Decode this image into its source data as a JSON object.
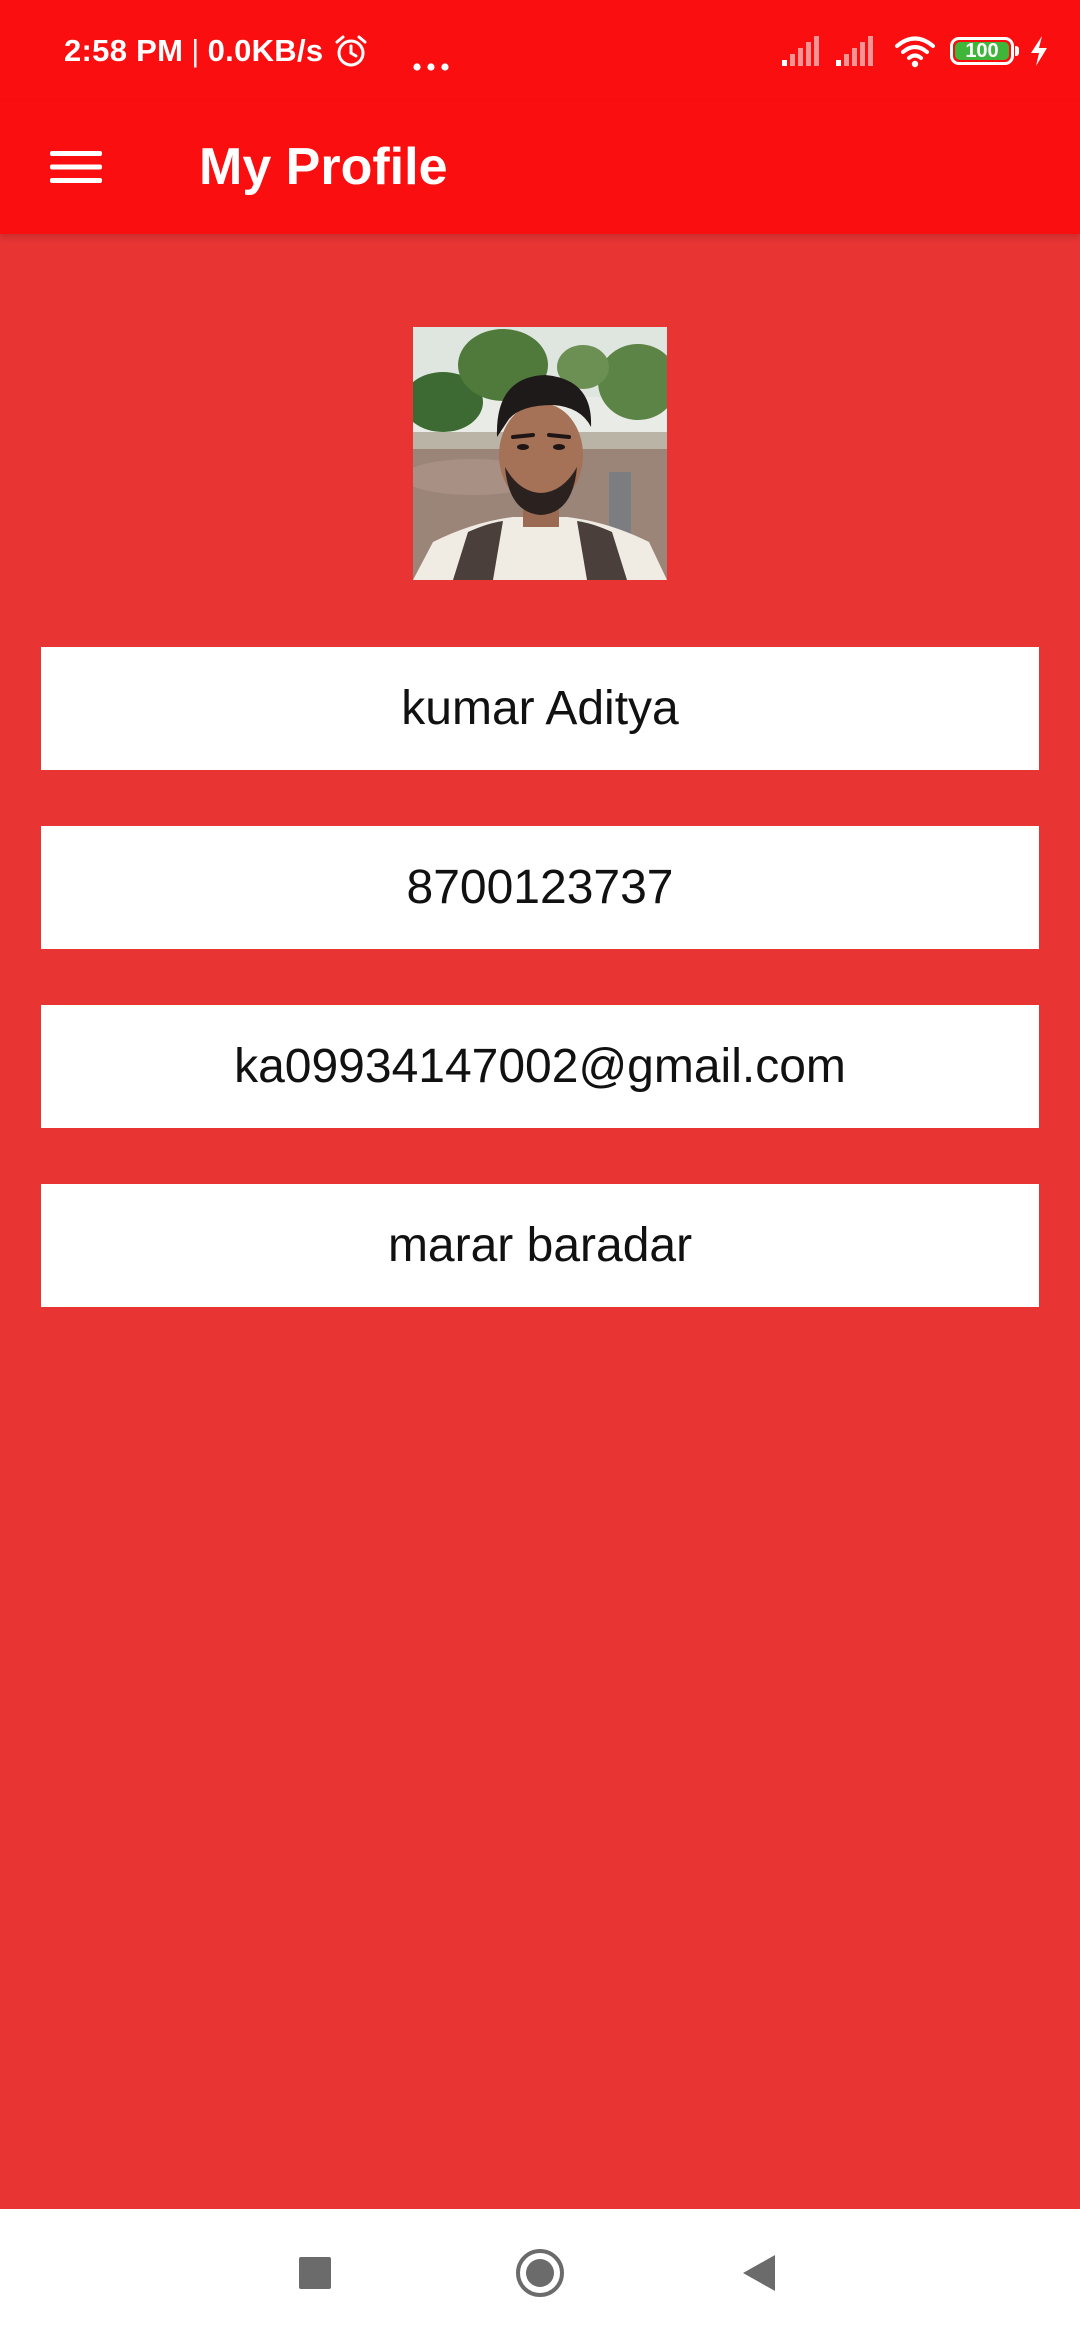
{
  "status_bar": {
    "time": "2:58 PM",
    "separator": "|",
    "network_speed": "0.0KB/s",
    "alarm_icon": "alarm-clock-icon",
    "more_icon": "more-dots-icon",
    "signal_icons": [
      "signal-sim1-icon",
      "signal-sim2-icon"
    ],
    "wifi_icon": "wifi-icon",
    "battery_level": "100",
    "battery_color": "#3FB53A",
    "charging_icon": "charging-bolt-icon"
  },
  "app_bar": {
    "menu_icon": "hamburger-menu-icon",
    "title": "My Profile",
    "color": "#FA0E10"
  },
  "profile": {
    "avatar": "profile-photo",
    "name": "kumar Aditya",
    "phone": "8700123737",
    "email": "ka09934147002@gmail.com",
    "address": "marar baradar"
  },
  "theme": {
    "background": "#E93434",
    "field_background": "#FFFFFF"
  },
  "nav_bar": {
    "recent_icon": "square-recents-icon",
    "home_icon": "circle-home-icon",
    "back_icon": "triangle-back-icon"
  }
}
